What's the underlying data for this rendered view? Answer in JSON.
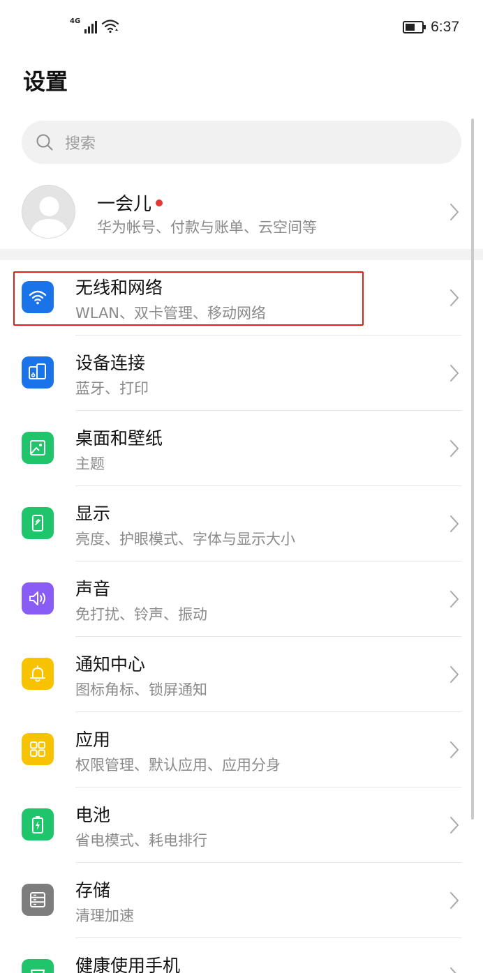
{
  "status_bar": {
    "network_type": "4G",
    "time": "6:37"
  },
  "page_title": "设置",
  "search": {
    "placeholder": "搜索"
  },
  "account": {
    "name": "一会儿",
    "subtitle": "华为帐号、付款与账单、云空间等",
    "has_notification_dot": true
  },
  "menu_items": [
    {
      "title": "无线和网络",
      "subtitle": "WLAN、双卡管理、移动网络",
      "icon": "wifi-icon",
      "color": "#1a73e8",
      "highlighted": true
    },
    {
      "title": "设备连接",
      "subtitle": "蓝牙、打印",
      "icon": "device-connection-icon",
      "color": "#1a73e8"
    },
    {
      "title": "桌面和壁纸",
      "subtitle": "主题",
      "icon": "wallpaper-icon",
      "color": "#1fc46b"
    },
    {
      "title": "显示",
      "subtitle": "亮度、护眼模式、字体与显示大小",
      "icon": "display-icon",
      "color": "#1fc46b"
    },
    {
      "title": "声音",
      "subtitle": "免打扰、铃声、振动",
      "icon": "sound-icon",
      "color": "#8a5cf6"
    },
    {
      "title": "通知中心",
      "subtitle": "图标角标、锁屏通知",
      "icon": "notification-bell-icon",
      "color": "#f7c200"
    },
    {
      "title": "应用",
      "subtitle": "权限管理、默认应用、应用分身",
      "icon": "apps-grid-icon",
      "color": "#f7c200"
    },
    {
      "title": "电池",
      "subtitle": "省电模式、耗电排行",
      "icon": "battery-icon",
      "color": "#1fc46b"
    },
    {
      "title": "存储",
      "subtitle": "清理加速",
      "icon": "storage-icon",
      "color": "#7d7d7d"
    },
    {
      "title": "健康使用手机",
      "subtitle": "",
      "icon": "digital-balance-icon",
      "color": "#1fc46b"
    }
  ],
  "colors": {
    "highlight_border": "#e0201b",
    "notification_dot": "#e53935"
  }
}
